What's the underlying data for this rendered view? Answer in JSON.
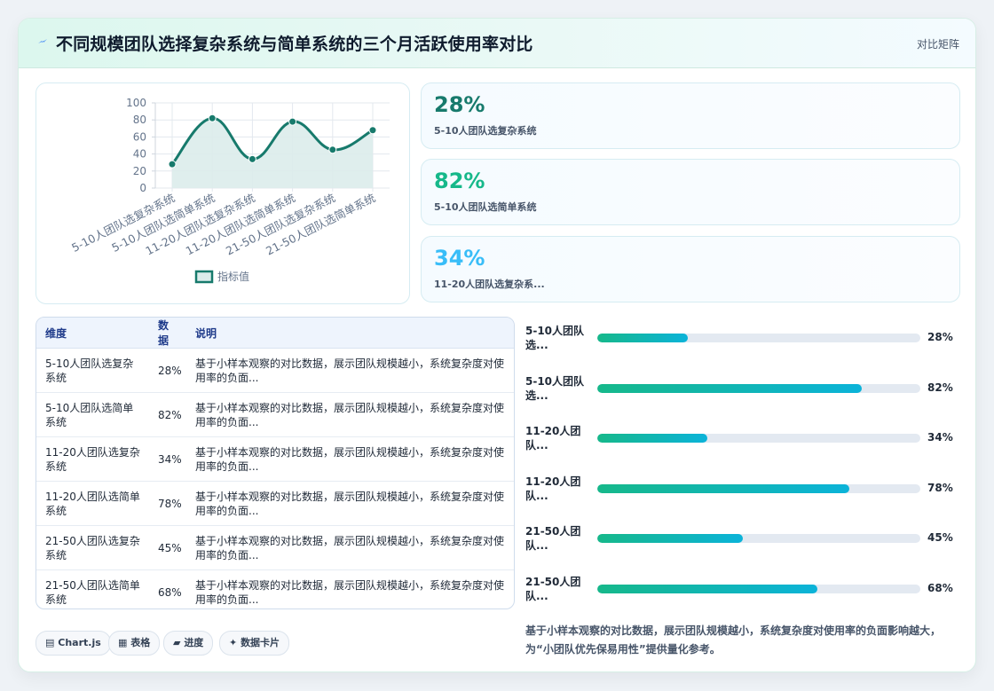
{
  "header": {
    "title": "不同规模团队选择复杂系统与简单系统的三个月活跃使用率对比",
    "tag": "对比矩阵"
  },
  "chart_data": {
    "type": "line",
    "categories": [
      "5-10人团队选复杂系统",
      "5-10人团队选简单系统",
      "11-20人团队选复杂系统",
      "11-20人团队选简单系统",
      "21-50人团队选复杂系统",
      "21-50人团队选简单系统"
    ],
    "series": [
      {
        "name": "指标值",
        "values": [
          28,
          82,
          34,
          78,
          45,
          68
        ]
      }
    ],
    "yticks": [
      0,
      20,
      40,
      60,
      80,
      100
    ],
    "ylim": [
      0,
      100
    ],
    "grid": true,
    "legend": "bottom",
    "line_color": "#177a6c",
    "fill_color": "#dceceb"
  },
  "stats": [
    {
      "value": "28%",
      "label": "5-10人团队选复杂系统",
      "color": "#177a6c"
    },
    {
      "value": "82%",
      "label": "5-10人团队选简单系统",
      "color": "#16b88a"
    },
    {
      "value": "34%",
      "label": "11-20人团队选复杂系...",
      "color": "#38bdf8"
    }
  ],
  "table": {
    "headers": [
      "维度",
      "数据",
      "说明"
    ],
    "rows": [
      {
        "dim": "5-10人团队选复杂系统",
        "val": "28%",
        "desc": "基于小样本观察的对比数据，展示团队规模越小，系统复杂度对使用率的负面..."
      },
      {
        "dim": "5-10人团队选简单系统",
        "val": "82%",
        "desc": "基于小样本观察的对比数据，展示团队规模越小，系统复杂度对使用率的负面..."
      },
      {
        "dim": "11-20人团队选复杂系统",
        "val": "34%",
        "desc": "基于小样本观察的对比数据，展示团队规模越小，系统复杂度对使用率的负面..."
      },
      {
        "dim": "11-20人团队选简单系统",
        "val": "78%",
        "desc": "基于小样本观察的对比数据，展示团队规模越小，系统复杂度对使用率的负面..."
      },
      {
        "dim": "21-50人团队选复杂系统",
        "val": "45%",
        "desc": "基于小样本观察的对比数据，展示团队规模越小，系统复杂度对使用率的负面..."
      },
      {
        "dim": "21-50人团队选简单系统",
        "val": "68%",
        "desc": "基于小样本观察的对比数据，展示团队规模越小，系统复杂度对使用率的负面..."
      }
    ]
  },
  "bars": [
    {
      "label": "5-10人团队选...",
      "pct": "28%",
      "value": 28
    },
    {
      "label": "5-10人团队选...",
      "pct": "82%",
      "value": 82
    },
    {
      "label": "11-20人团队...",
      "pct": "34%",
      "value": 34
    },
    {
      "label": "11-20人团队...",
      "pct": "78%",
      "value": 78
    },
    {
      "label": "21-50人团队...",
      "pct": "45%",
      "value": 45
    },
    {
      "label": "21-50人团队...",
      "pct": "68%",
      "value": 68
    }
  ],
  "summary": "基于小样本观察的对比数据，展示团队规模越小，系统复杂度对使用率的负面影响越大，为“小团队优先保易用性”提供量化参考。",
  "chips": [
    {
      "icon": "▤",
      "label": "Chart.js"
    },
    {
      "icon": "▦",
      "label": "表格"
    },
    {
      "icon": "▰",
      "label": "进度"
    },
    {
      "icon": "✦",
      "label": "数据卡片"
    }
  ]
}
